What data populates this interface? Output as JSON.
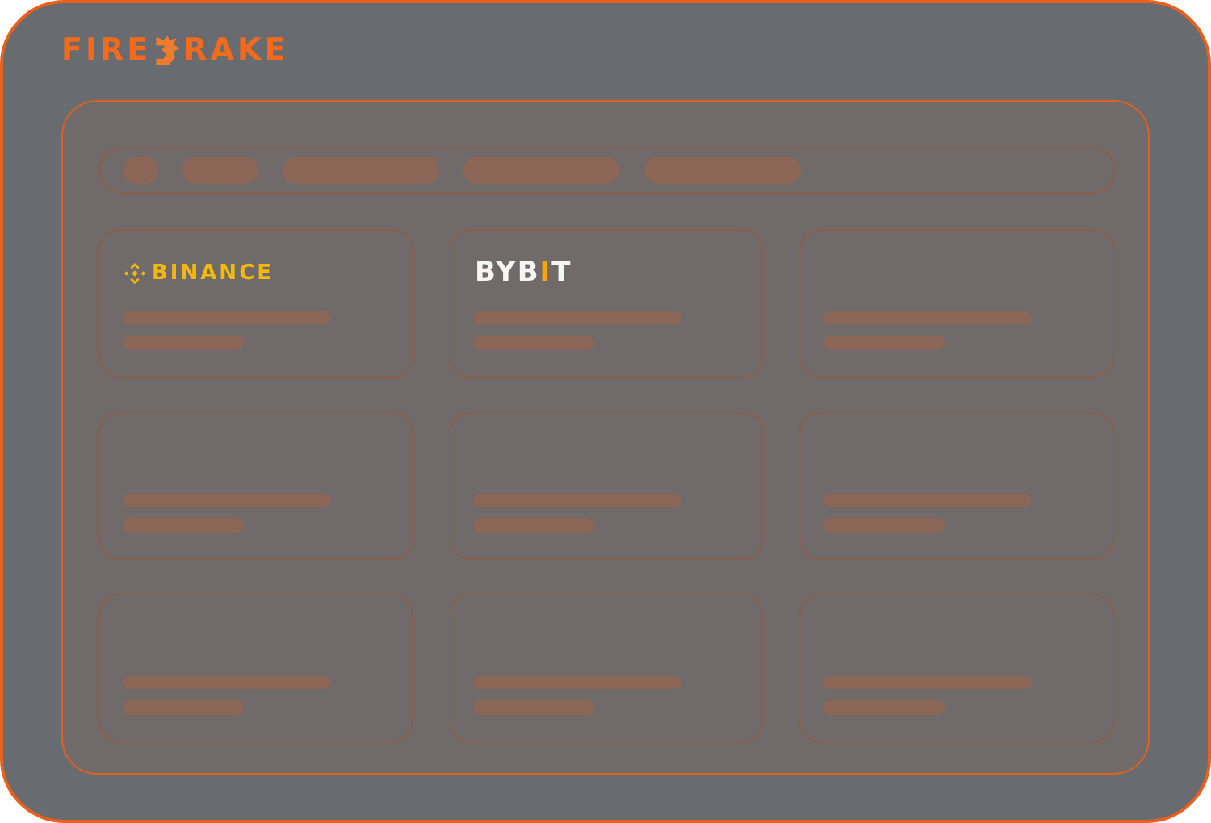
{
  "logo": {
    "start": "FIRE",
    "end": "RAKE"
  },
  "cards": [
    {
      "kind": "binance",
      "name": "BINANCE"
    },
    {
      "kind": "bybit",
      "before": "BYB",
      "accent": "I",
      "after": "T"
    },
    {
      "kind": "empty"
    },
    {
      "kind": "empty"
    },
    {
      "kind": "empty"
    },
    {
      "kind": "empty"
    },
    {
      "kind": "empty"
    },
    {
      "kind": "empty"
    },
    {
      "kind": "empty"
    }
  ]
}
